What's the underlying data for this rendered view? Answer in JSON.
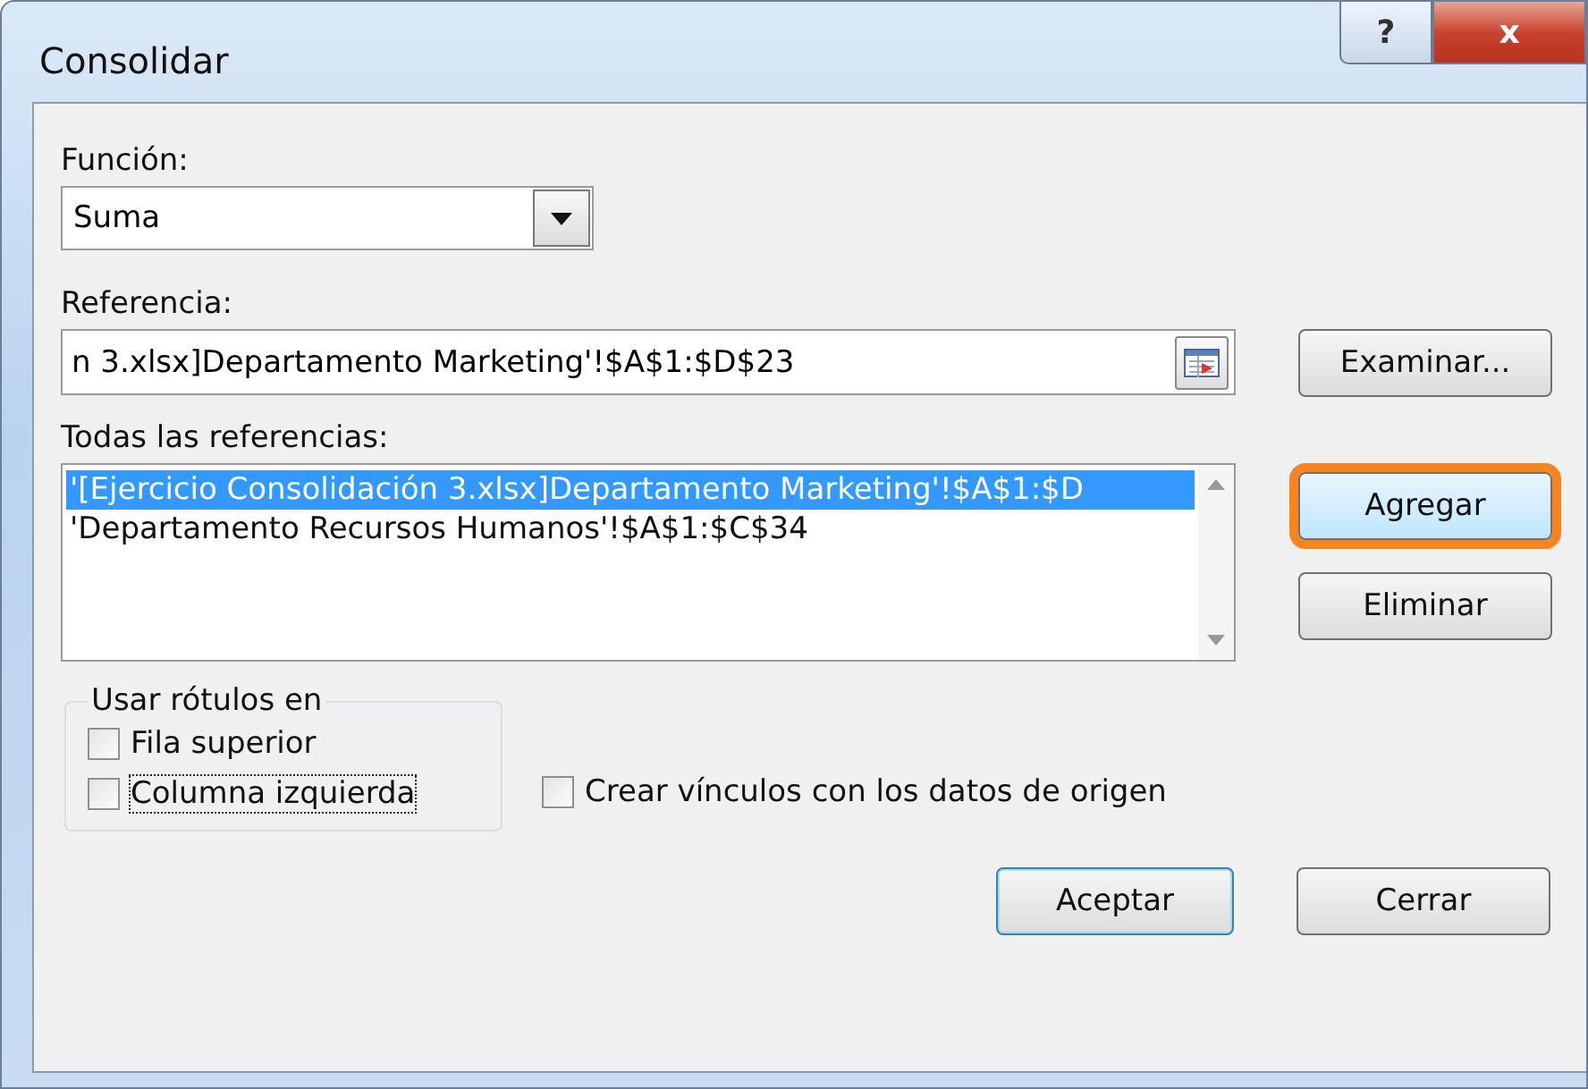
{
  "window": {
    "title": "Consolidar",
    "controls": [
      "?",
      "x"
    ]
  },
  "function": {
    "label": "Función:",
    "value": "Suma"
  },
  "reference": {
    "label": "Referencia:",
    "value": "n 3.xlsx]Departamento Marketing'!$A$1:$D$23",
    "browse_button": "Examinar..."
  },
  "all_references": {
    "label": "Todas las referencias:",
    "items": [
      {
        "text": "'[Ejercicio Consolidación 3.xlsx]Departamento Marketing'!$A$1:$D",
        "selected": true
      },
      {
        "text": "'Departamento Recursos Humanos'!$A$1:$C$34",
        "selected": false
      }
    ]
  },
  "side_buttons": [
    {
      "label": "Agregar",
      "highlighted": true
    },
    {
      "label": "Eliminar",
      "highlighted": false
    }
  ],
  "labels_group": {
    "title": "Usar rótulos en",
    "options": [
      {
        "label": "Fila superior",
        "checked": false,
        "focused": false
      },
      {
        "label": "Columna izquierda",
        "checked": false,
        "focused": true
      }
    ]
  },
  "link_option": {
    "label": "Crear vínculos con los datos de origen",
    "checked": false
  },
  "buttons": [
    {
      "label": "Aceptar",
      "default": true
    },
    {
      "label": "Cerrar",
      "default": false
    }
  ]
}
